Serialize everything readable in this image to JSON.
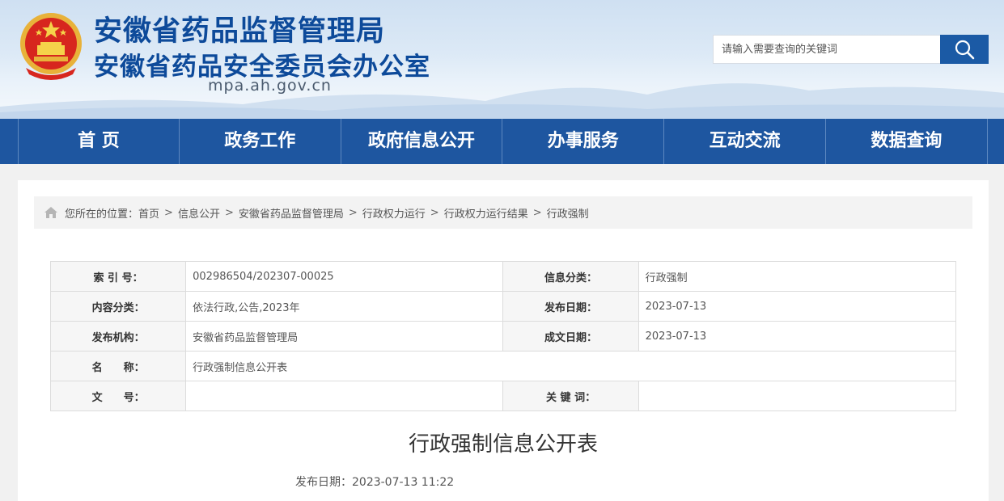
{
  "header": {
    "title_line1": "安徽省药品监督管理局",
    "title_line2": "安徽省药品安全委员会办公室",
    "domain": "mpa.ah.gov.cn",
    "emblem_icon": "national-emblem-icon"
  },
  "search": {
    "placeholder": "请输入需要查询的关键词",
    "button_icon": "search-icon"
  },
  "nav": {
    "items": [
      "首 页",
      "政务工作",
      "政府信息公开",
      "办事服务",
      "互动交流",
      "数据查询"
    ]
  },
  "breadcrumb": {
    "prefix": "您所在的位置：",
    "items": [
      "首页",
      "信息公开",
      "安徽省药品监督管理局",
      "行政权力运行",
      "行政权力运行结果",
      "行政强制"
    ],
    "separator": ">"
  },
  "meta": {
    "index_label": "索 引 号：",
    "index_value": "002986504/202307-00025",
    "category_label": "信息分类：",
    "category_value": "行政强制",
    "content_type_label": "内容分类：",
    "content_type_value": "依法行政,公告,2023年",
    "publish_date_label": "发布日期：",
    "publish_date_value": "2023-07-13",
    "publisher_label": "发布机构：",
    "publisher_value": "安徽省药品监督管理局",
    "written_date_label": "成文日期：",
    "written_date_value": "2023-07-13",
    "name_label": "名　　称：",
    "name_value": "行政强制信息公开表",
    "doc_no_label": "文　　号：",
    "doc_no_value": "",
    "keywords_label": "关 键 词：",
    "keywords_value": ""
  },
  "article": {
    "title": "行政强制信息公开表",
    "date_label": "发布日期：",
    "date_value": "2023-07-13 11:22"
  },
  "colors": {
    "nav_bg": "#1e56a0",
    "title_blue": "#0d4a9a",
    "search_btn": "#1b5aa5"
  }
}
